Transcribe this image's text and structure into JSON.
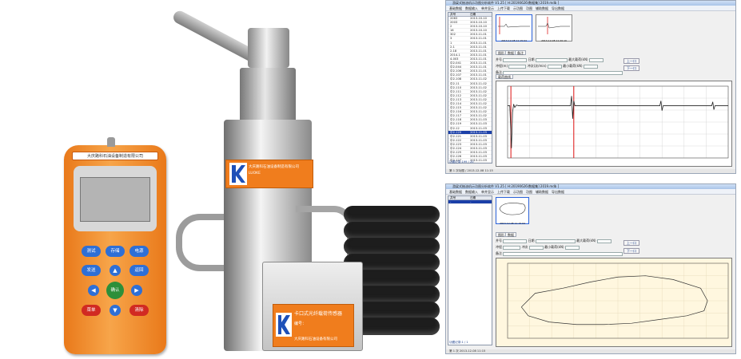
{
  "handheld": {
    "label": "大庆路科石油设备制造有限公司",
    "keys": {
      "test": "测试",
      "store": "存储",
      "power": "电源",
      "send": "发送",
      "back": "返回",
      "confirm": "确认",
      "menu": "菜单",
      "clear": "清除"
    },
    "colors": {
      "body": "#f28a24",
      "keys": "#2e6fd6",
      "ok_key": "#2d8f3a",
      "warn_key": "#d12a22"
    }
  },
  "instrument": {
    "tag_lines": [
      "大庆路科石油设备制造有限公司",
      "LUOKE"
    ],
    "sensor_title": "卡口式光纤载荷传感器",
    "sensor_field": "编号：",
    "sensor_company": "大庆路科石油设备有限公司",
    "brand": "LUOKE"
  },
  "software_top": {
    "title": "游梁式抽油机示功图分析软件 V1.25 [ H:20190626\\数据集] 2019.mdb ]",
    "toolbar": [
      "基础数据",
      "数据输入",
      "单井显示",
      "上传下载",
      "示功图",
      "功图",
      "辅助数据",
      "导出数据"
    ],
    "list_headers": [
      "井号",
      "日期"
    ],
    "list_rows": [
      [
        "2063",
        "2013-10-10"
      ],
      [
        "2003",
        "2013-10-10"
      ],
      [
        "2",
        "2013-10-10"
      ],
      [
        "16",
        "2013-10-10"
      ],
      [
        "302",
        "2013-11-01"
      ],
      [
        "3",
        "2013-11-01"
      ],
      [
        "1",
        "2013-11-01"
      ],
      [
        "2-1",
        "2013-11-01"
      ],
      [
        "2-18",
        "2013-11-01"
      ],
      [
        "2014-1",
        "2013-11-01"
      ],
      [
        "4-003",
        "2013-11-01"
      ],
      [
        "中2-041",
        "2013-11-01"
      ],
      [
        "中2-044",
        "2013-11-01"
      ],
      [
        "中2-106",
        "2013-11-01"
      ],
      [
        "中2-107",
        "2013-11-01"
      ],
      [
        "中2-108",
        "2013-11-02"
      ],
      [
        "中2-11",
        "2013-11-02"
      ],
      [
        "中2-110",
        "2013-11-02"
      ],
      [
        "中2-111",
        "2013-11-02"
      ],
      [
        "中2-112",
        "2013-11-02"
      ],
      [
        "中2-113",
        "2013-11-02"
      ],
      [
        "中2-114",
        "2013-11-02"
      ],
      [
        "中2-115",
        "2013-11-02"
      ],
      [
        "中2-116",
        "2013-11-02"
      ],
      [
        "中2-117",
        "2013-11-02"
      ],
      [
        "中2-118",
        "2013-11-03"
      ],
      [
        "中2-119",
        "2013-11-03"
      ],
      [
        "中2-12",
        "2013-11-03"
      ],
      [
        "中2-120",
        "2013-11-03"
      ],
      [
        "中2-121",
        "2013-11-03"
      ],
      [
        "中2-122",
        "2013-11-03"
      ],
      [
        "中2-123",
        "2013-11-03"
      ],
      [
        "中2-124",
        "2013-11-03"
      ],
      [
        "中2-125",
        "2013-11-03"
      ],
      [
        "中2-126",
        "2013-11-03"
      ],
      [
        "中2-127",
        "2013-11-03"
      ]
    ],
    "selected_row": 28,
    "thumbs": [
      "2013-12-08 11:15:04",
      "2013-12-08 11:20:10"
    ],
    "tabs": [
      "图形",
      "数据",
      "备注"
    ],
    "form": {
      "well": "井号",
      "date": "日期",
      "stroke": "冲程(m)",
      "freq": "冲次(次/min)",
      "max_load": "最大载荷(kN)",
      "min_load": "最小载荷(kN)",
      "note": "备注"
    },
    "nav": [
      "上一口",
      "下一口"
    ],
    "chart_tab": "载荷曲线",
    "counts": "功图记录:199 / 20",
    "status": "第 1 次功图 / 2013-12-08 11:15"
  },
  "software_bottom": {
    "title": "游梁式抽油机示功图分析软件 V1.25 [ H:20190626\\数据集] 2019.mdb ]",
    "toolbar": [
      "基础数据",
      "数据输入",
      "单井显示",
      "上传下载",
      "示功图",
      "功图",
      "辅助数据",
      "导出数据"
    ],
    "list_headers": [
      "井号",
      "日期"
    ],
    "list_rows": [
      [
        "-",
        "-"
      ]
    ],
    "thumb_caption": "2013-12-08 11:15:04",
    "tabs": [
      "图形",
      "数据"
    ],
    "form": {
      "well": "井号",
      "date": "日期",
      "stroke": "冲程",
      "freq": "冲次",
      "max_load": "最大载荷(kN)",
      "min_load": "最小载荷(kN)",
      "note": "备注"
    },
    "nav": [
      "上一口",
      "下一口"
    ],
    "counts": "功图记录:1 / 1",
    "status": "第 1 次 2013-12-08 11:15"
  },
  "chart_data": [
    {
      "type": "line",
      "title": "",
      "xlabel": "",
      "ylabel": "",
      "xlim": [
        0,
        4000
      ],
      "ylim": [
        -1.6,
        0.6
      ],
      "series": [
        {
          "x": [
            0,
            40,
            70,
            90,
            110,
            130,
            160,
            200,
            260,
            400,
            600,
            800,
            1000,
            1140,
            1160,
            1180,
            1200,
            1220,
            1260,
            1400,
            1800,
            2200,
            2600,
            2760,
            2780,
            2800,
            2820,
            3000,
            3400,
            3700,
            3720,
            3740,
            3760,
            4000
          ],
          "y": [
            0.0,
            0.0,
            -1.3,
            -0.2,
            0.05,
            -0.05,
            0.02,
            0.0,
            0.0,
            0.0,
            0.0,
            0.0,
            0.0,
            0.0,
            0.3,
            -0.4,
            0.15,
            0.0,
            0.0,
            0.0,
            0.0,
            0.0,
            0.0,
            0.0,
            0.15,
            -0.15,
            0.0,
            0.0,
            0.0,
            0.0,
            0.12,
            -0.12,
            0.0,
            0.0
          ]
        }
      ],
      "markers": [
        60,
        1200
      ]
    },
    {
      "type": "line",
      "title": "",
      "xlabel": "",
      "ylabel": "",
      "xlim": [
        0,
        3.2
      ],
      "ylim": [
        0,
        60
      ],
      "series": [
        {
          "x": [
            0.2,
            0.4,
            0.8,
            1.2,
            1.6,
            2.0,
            2.4,
            2.8,
            2.9,
            2.85,
            2.6,
            2.2,
            1.8,
            1.4,
            1.0,
            0.6,
            0.3,
            0.2
          ],
          "y": [
            25,
            36,
            40,
            45,
            49,
            50,
            47,
            40,
            30,
            22,
            18,
            15,
            12,
            11,
            11,
            13,
            18,
            25
          ]
        }
      ]
    }
  ]
}
